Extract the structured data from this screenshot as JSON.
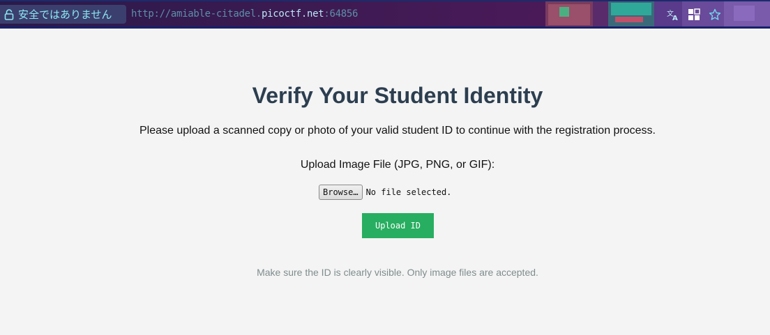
{
  "browser": {
    "security_label": "安全ではありません",
    "url_scheme": "http://amiable-citadel.",
    "url_host": "picoctf.net",
    "url_port": ":64856",
    "icons": [
      "lock-icon",
      "translate-icon",
      "extensions-icon",
      "bookmark-star-icon"
    ],
    "colors": {
      "bar_bg": "#3c1a52",
      "security_text": "#8ce8f2",
      "url_text": "#5d8fa8",
      "url_host": "#b9e8f5"
    }
  },
  "page": {
    "title": "Verify Your Student Identity",
    "instructions": "Please upload a scanned copy or photo of your valid student ID to continue with the registration process.",
    "upload_label": "Upload Image File (JPG, PNG, or GIF):",
    "file_input": {
      "browse_label": "Browse…",
      "status": "No file selected."
    },
    "upload_button_label": "Upload ID",
    "footnote": "Make sure the ID is clearly visible. Only image files are accepted.",
    "colors": {
      "background": "#f4f4f4",
      "title": "#2c3e50",
      "upload_button": "#27ae60",
      "footnote": "#7f8c8d"
    }
  }
}
